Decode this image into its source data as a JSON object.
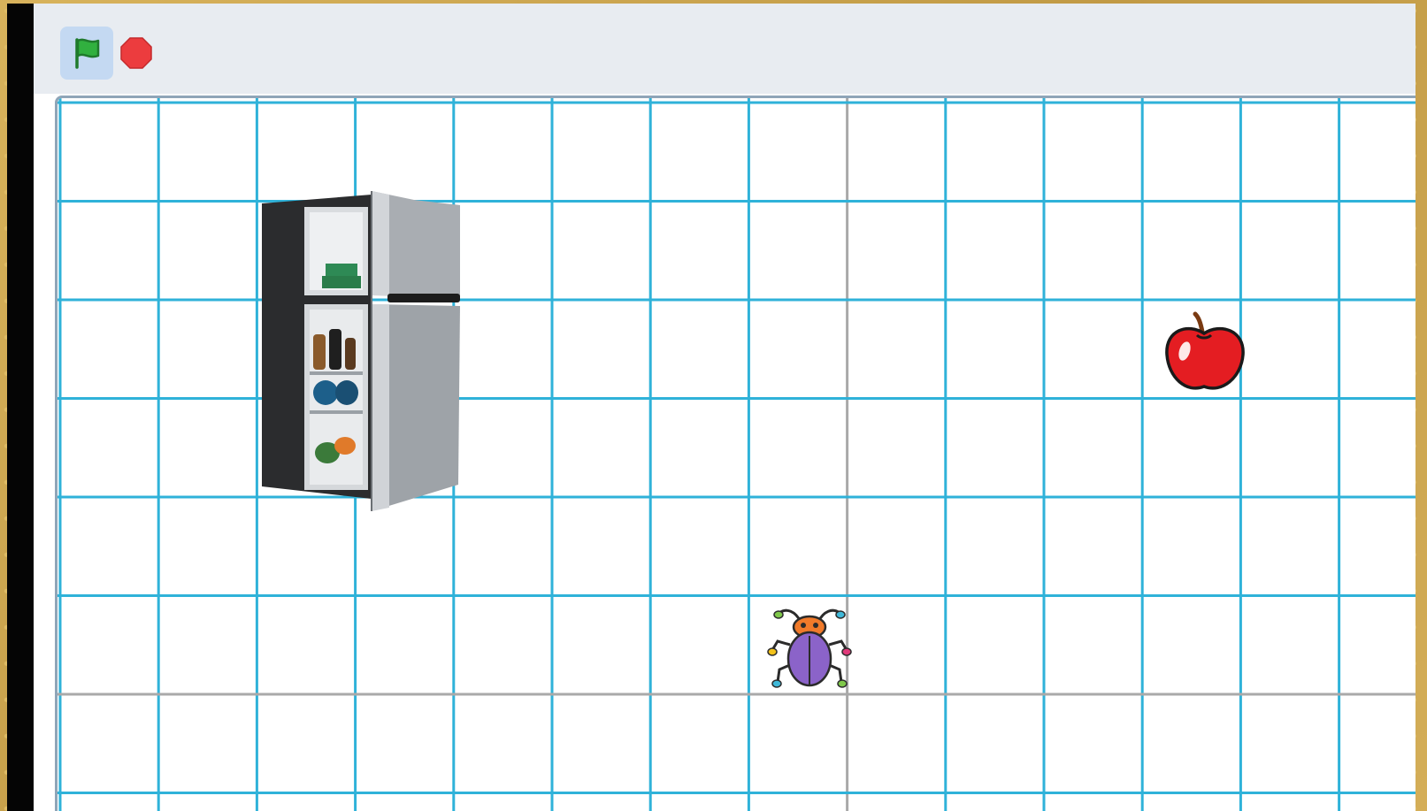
{
  "toolbar": {
    "green_flag": {
      "icon": "green-flag-icon",
      "color": "#29a83a",
      "active_bg": "#c4d9f2"
    },
    "stop": {
      "icon": "stop-sign-icon",
      "color": "#e8393a"
    }
  },
  "stage": {
    "grid_color": "#2fb2d9",
    "axis_color": "#a9a9a9",
    "background": "#ffffff"
  },
  "sprites": [
    {
      "name": "refrigerator",
      "icon": "refrigerator-icon"
    },
    {
      "name": "apple",
      "icon": "apple-icon",
      "color": "#e41d22"
    },
    {
      "name": "beetle",
      "icon": "beetle-icon",
      "color": "#8b63c9"
    }
  ]
}
